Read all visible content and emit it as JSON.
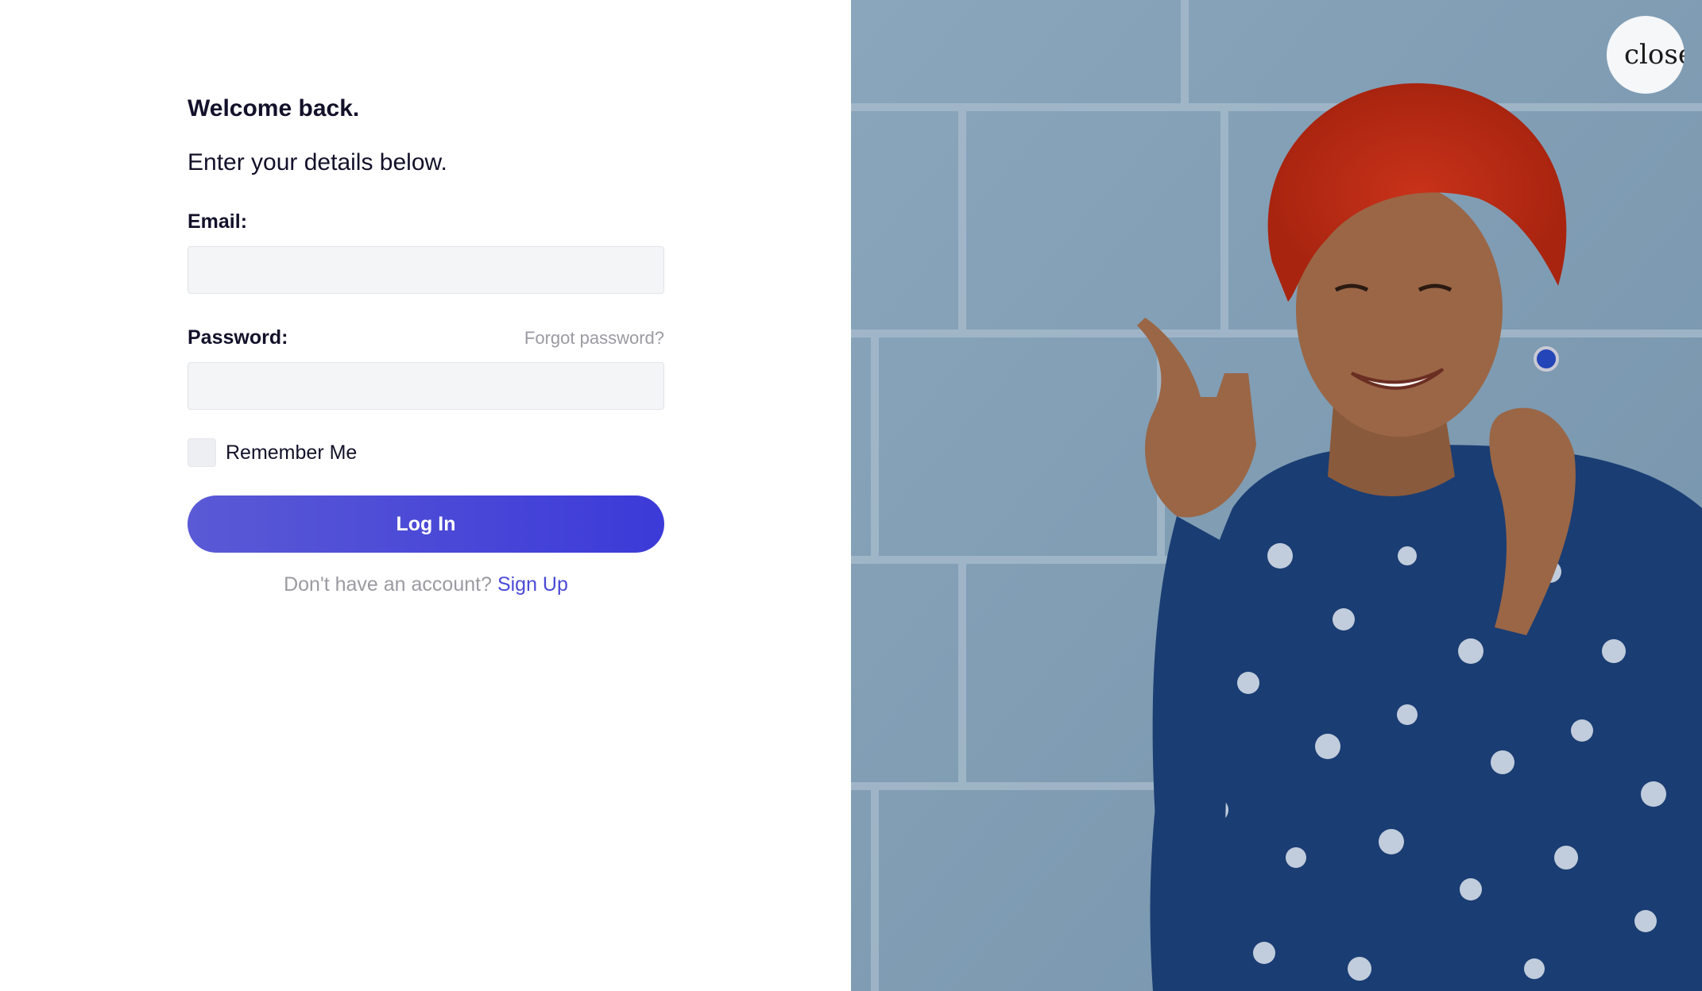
{
  "login": {
    "heading": "Welcome back.",
    "subtitle": "Enter your details below.",
    "email_label": "Email:",
    "email_value": "",
    "password_label": "Password:",
    "password_value": "",
    "forgot_password": "Forgot password?",
    "remember_me": "Remember Me",
    "login_button": "Log In",
    "no_account_text": "Don't have an account?",
    "signup_link": "Sign Up"
  },
  "hero": {
    "close_label": "close"
  },
  "colors": {
    "accent": "#4b4ad8",
    "button_gradient_start": "#5a5ad6",
    "button_gradient_end": "#3c3ad8",
    "wall_blue": "#7f9cb3",
    "text_dark": "#13112a",
    "text_muted": "#9a9aa2",
    "input_bg": "#f4f5f7"
  },
  "icons": {
    "close": "close-icon"
  }
}
